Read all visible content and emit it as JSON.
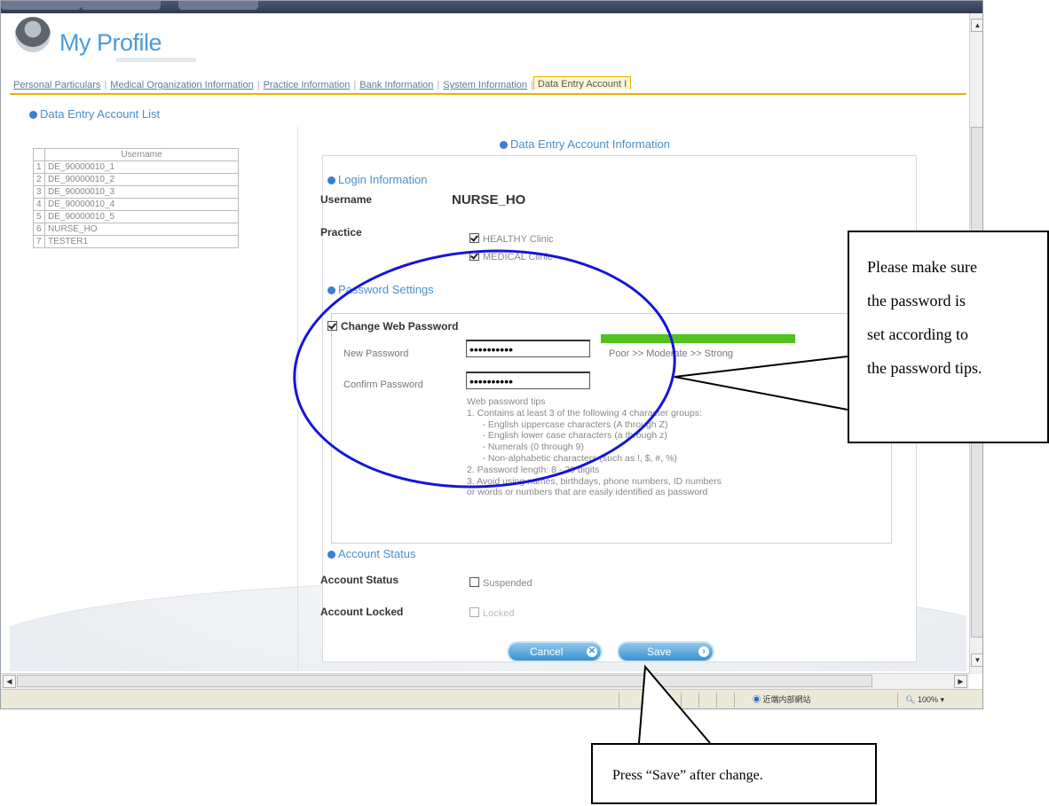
{
  "page": {
    "title": "My Profile"
  },
  "tabs": [
    {
      "label": "Personal Particulars"
    },
    {
      "label": "Medical Organization Information"
    },
    {
      "label": "Practice Information"
    },
    {
      "label": "Bank Information"
    },
    {
      "label": "System Information"
    },
    {
      "label": "Data Entry Account I"
    }
  ],
  "account_list": {
    "heading": "Data Entry Account List",
    "column_header": "Username",
    "rows": [
      {
        "num": "1",
        "username": "DE_90000010_1"
      },
      {
        "num": "2",
        "username": "DE_90000010_2"
      },
      {
        "num": "3",
        "username": "DE_90000010_3"
      },
      {
        "num": "4",
        "username": "DE_90000010_4"
      },
      {
        "num": "5",
        "username": "DE_90000010_5"
      },
      {
        "num": "6",
        "username": "NURSE_HO"
      },
      {
        "num": "7",
        "username": "TESTER1"
      }
    ]
  },
  "account_info": {
    "heading": "Data Entry Account Information",
    "login_section": "Login Information",
    "username_label": "Username",
    "username_value": "NURSE_HO",
    "practice_label": "Practice",
    "practices": [
      {
        "label": "HEALTHY Clinic",
        "checked": true
      },
      {
        "label": "MEDICAL Clinic",
        "checked": true
      }
    ],
    "password_section": "Password Settings",
    "change_password_label": "Change Web Password",
    "change_password_checked": true,
    "new_password_label": "New Password",
    "new_password_value": "••••••••••",
    "confirm_password_label": "Confirm Password",
    "confirm_password_value": "••••••••••",
    "strength_text": "Poor   >> Moderate >>  Strong",
    "strength_level": "Strong",
    "tips": "Web password tips\n1. Contains at least 3 of the following 4 character groups:\n      - English uppercase characters (A through Z)\n      - English lower case characters (a through z)\n      - Numerals (0 through 9)\n      - Non-alphabetic characters (such as !, $, #, %)\n2. Password length: 8 - 20 digits\n3. Avoid using names, birthdays, phone numbers, ID numbers\nor words or numbers that are easily identified as password",
    "status_section": "Account Status",
    "account_status_label": "Account Status",
    "suspended_label": "Suspended",
    "account_locked_label": "Account Locked",
    "locked_label": "Locked"
  },
  "buttons": {
    "cancel": "Cancel",
    "save": "Save"
  },
  "statusbar": {
    "zone": "近端内部網站",
    "zoom": "100%"
  },
  "annotations": {
    "password_callout": [
      "Please make sure",
      "the password is",
      "set according to",
      "the password tips."
    ],
    "save_callout": "Press “Save” after change."
  },
  "colors": {
    "accent_blue": "#4a90c8",
    "tab_active_border": "#f0b000",
    "strength_bar": "#53c11e",
    "annotation_circle": "#1414d8"
  }
}
